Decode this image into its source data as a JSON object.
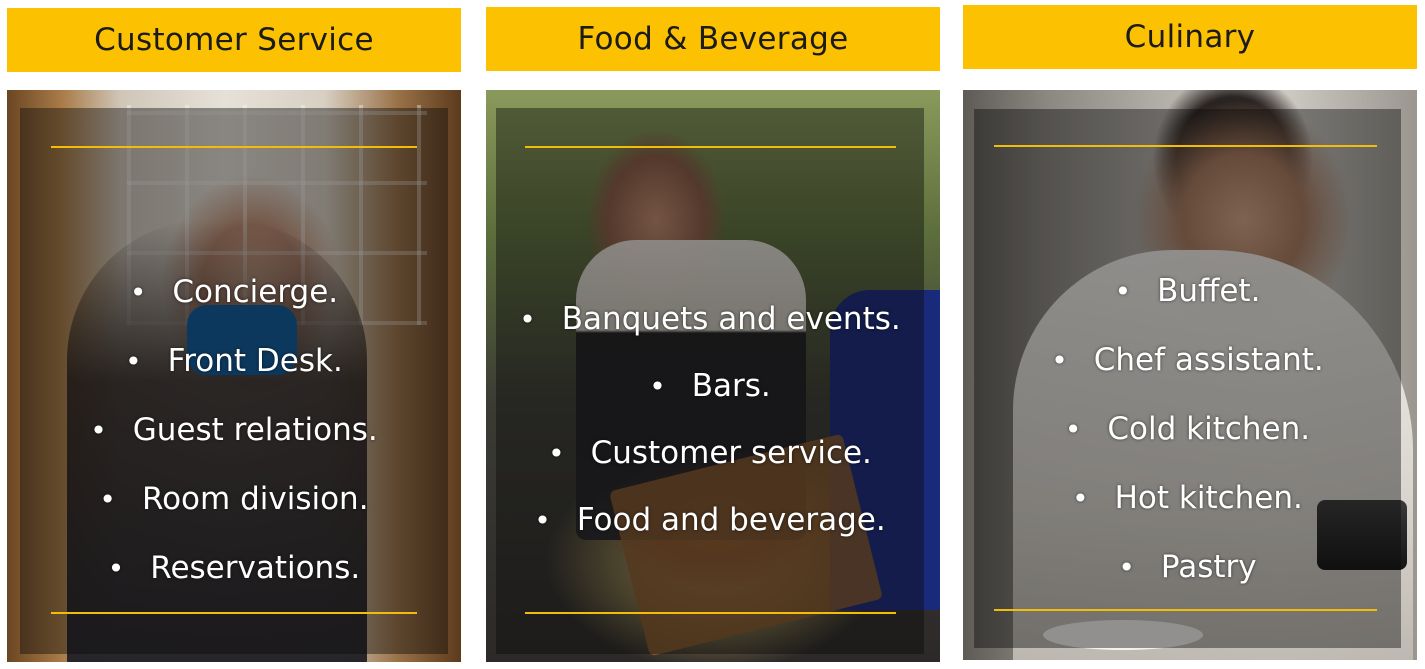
{
  "columns": [
    {
      "title": "Customer Service",
      "items": [
        "Concierge.",
        "Front Desk.",
        "Guest relations.",
        "Room division.",
        "Reservations."
      ]
    },
    {
      "title": "Food & Beverage",
      "items": [
        "Banquets and events.",
        "Bars.",
        "Customer service.",
        "Food and beverage."
      ]
    },
    {
      "title": "Culinary",
      "items": [
        "Buffet.",
        "Chef assistant.",
        "Cold kitchen.",
        "Hot kitchen.",
        "Pastry"
      ]
    }
  ],
  "colors": {
    "header_background": "#fcc100",
    "rule": "#f2bc0d",
    "overlay": "rgba(10,10,10,0.42)",
    "bullet_text": "#ffffff"
  }
}
